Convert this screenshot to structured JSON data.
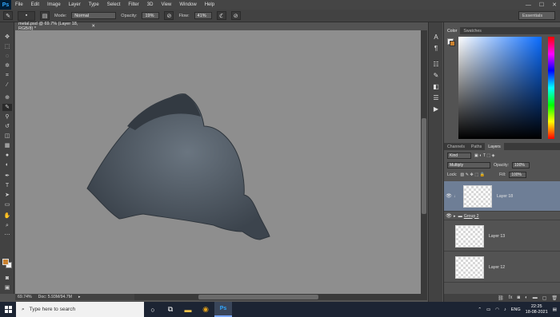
{
  "app": {
    "logo": "Ps",
    "menu": [
      "File",
      "Edit",
      "Image",
      "Layer",
      "Type",
      "Select",
      "Filter",
      "3D",
      "View",
      "Window",
      "Help"
    ],
    "window_controls": [
      "—",
      "☐",
      "✕"
    ]
  },
  "options": {
    "mode_label": "Mode:",
    "mode_value": "Normal",
    "opacity_label": "Opacity:",
    "opacity_value": "19%",
    "flow_label": "Flow:",
    "flow_value": "41%",
    "workspace": "Essentials"
  },
  "document": {
    "tab_title": "metal.psd @ 69.7% (Layer 18, RGB/8) *",
    "zoom": "69.74%",
    "doc_size": "Doc: 5.93M/94.7M"
  },
  "colors": {
    "foreground": "#c9812f",
    "background": "#f2f2f2",
    "layer_selected": "#6e7e96",
    "shape_fill": "#4b5560"
  },
  "color_panel": {
    "tabs": [
      "Color",
      "Swatches"
    ]
  },
  "layers_panel": {
    "tabs": [
      "Channels",
      "Paths",
      "Layers"
    ],
    "kind_label": "Kind",
    "blend_mode": "Multiply",
    "opacity_label": "Opacity:",
    "opacity_value": "100%",
    "lock_label": "Lock:",
    "fill_label": "Fill:",
    "fill_value": "100%",
    "layers": [
      {
        "name": "Layer 18",
        "selected": true
      },
      {
        "name": "Group 2",
        "group": true
      },
      {
        "name": "Layer 13",
        "selected": false
      },
      {
        "name": "Layer 12",
        "selected": false
      }
    ]
  },
  "taskbar": {
    "search_placeholder": "Type here to search",
    "language": "ENG",
    "time": "22:25",
    "date": "18-08-2021"
  }
}
